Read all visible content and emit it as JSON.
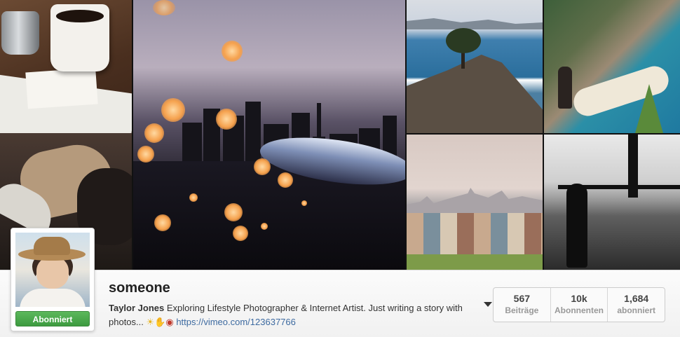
{
  "profile": {
    "username": "someone",
    "full_name": "Taylor Jones",
    "bio_text": "Exploring Lifestyle Photographer & Internet Artist. Just writing a story with photos...",
    "emoji": [
      "sun-emoji",
      "hand-emoji",
      "camera-emoji"
    ],
    "website": "https://vimeo.com/123637766",
    "follow_button_label": "Abonniert"
  },
  "stats": [
    {
      "value": "567",
      "label": "Beiträge"
    },
    {
      "value": "10k",
      "label": "Abonnenten"
    },
    {
      "value": "1,684",
      "label": "abonniert"
    }
  ],
  "colors": {
    "follow_button": "#4cae4c",
    "link": "#3d6aa0",
    "bokeh": "#f5a14d"
  },
  "photos": [
    "coffee-photo",
    "shoes-photo",
    "city-night-photo",
    "coast-cypress-photo",
    "cliff-beach-photo",
    "painted-ladies-photo",
    "golden-gate-bw-photo"
  ]
}
